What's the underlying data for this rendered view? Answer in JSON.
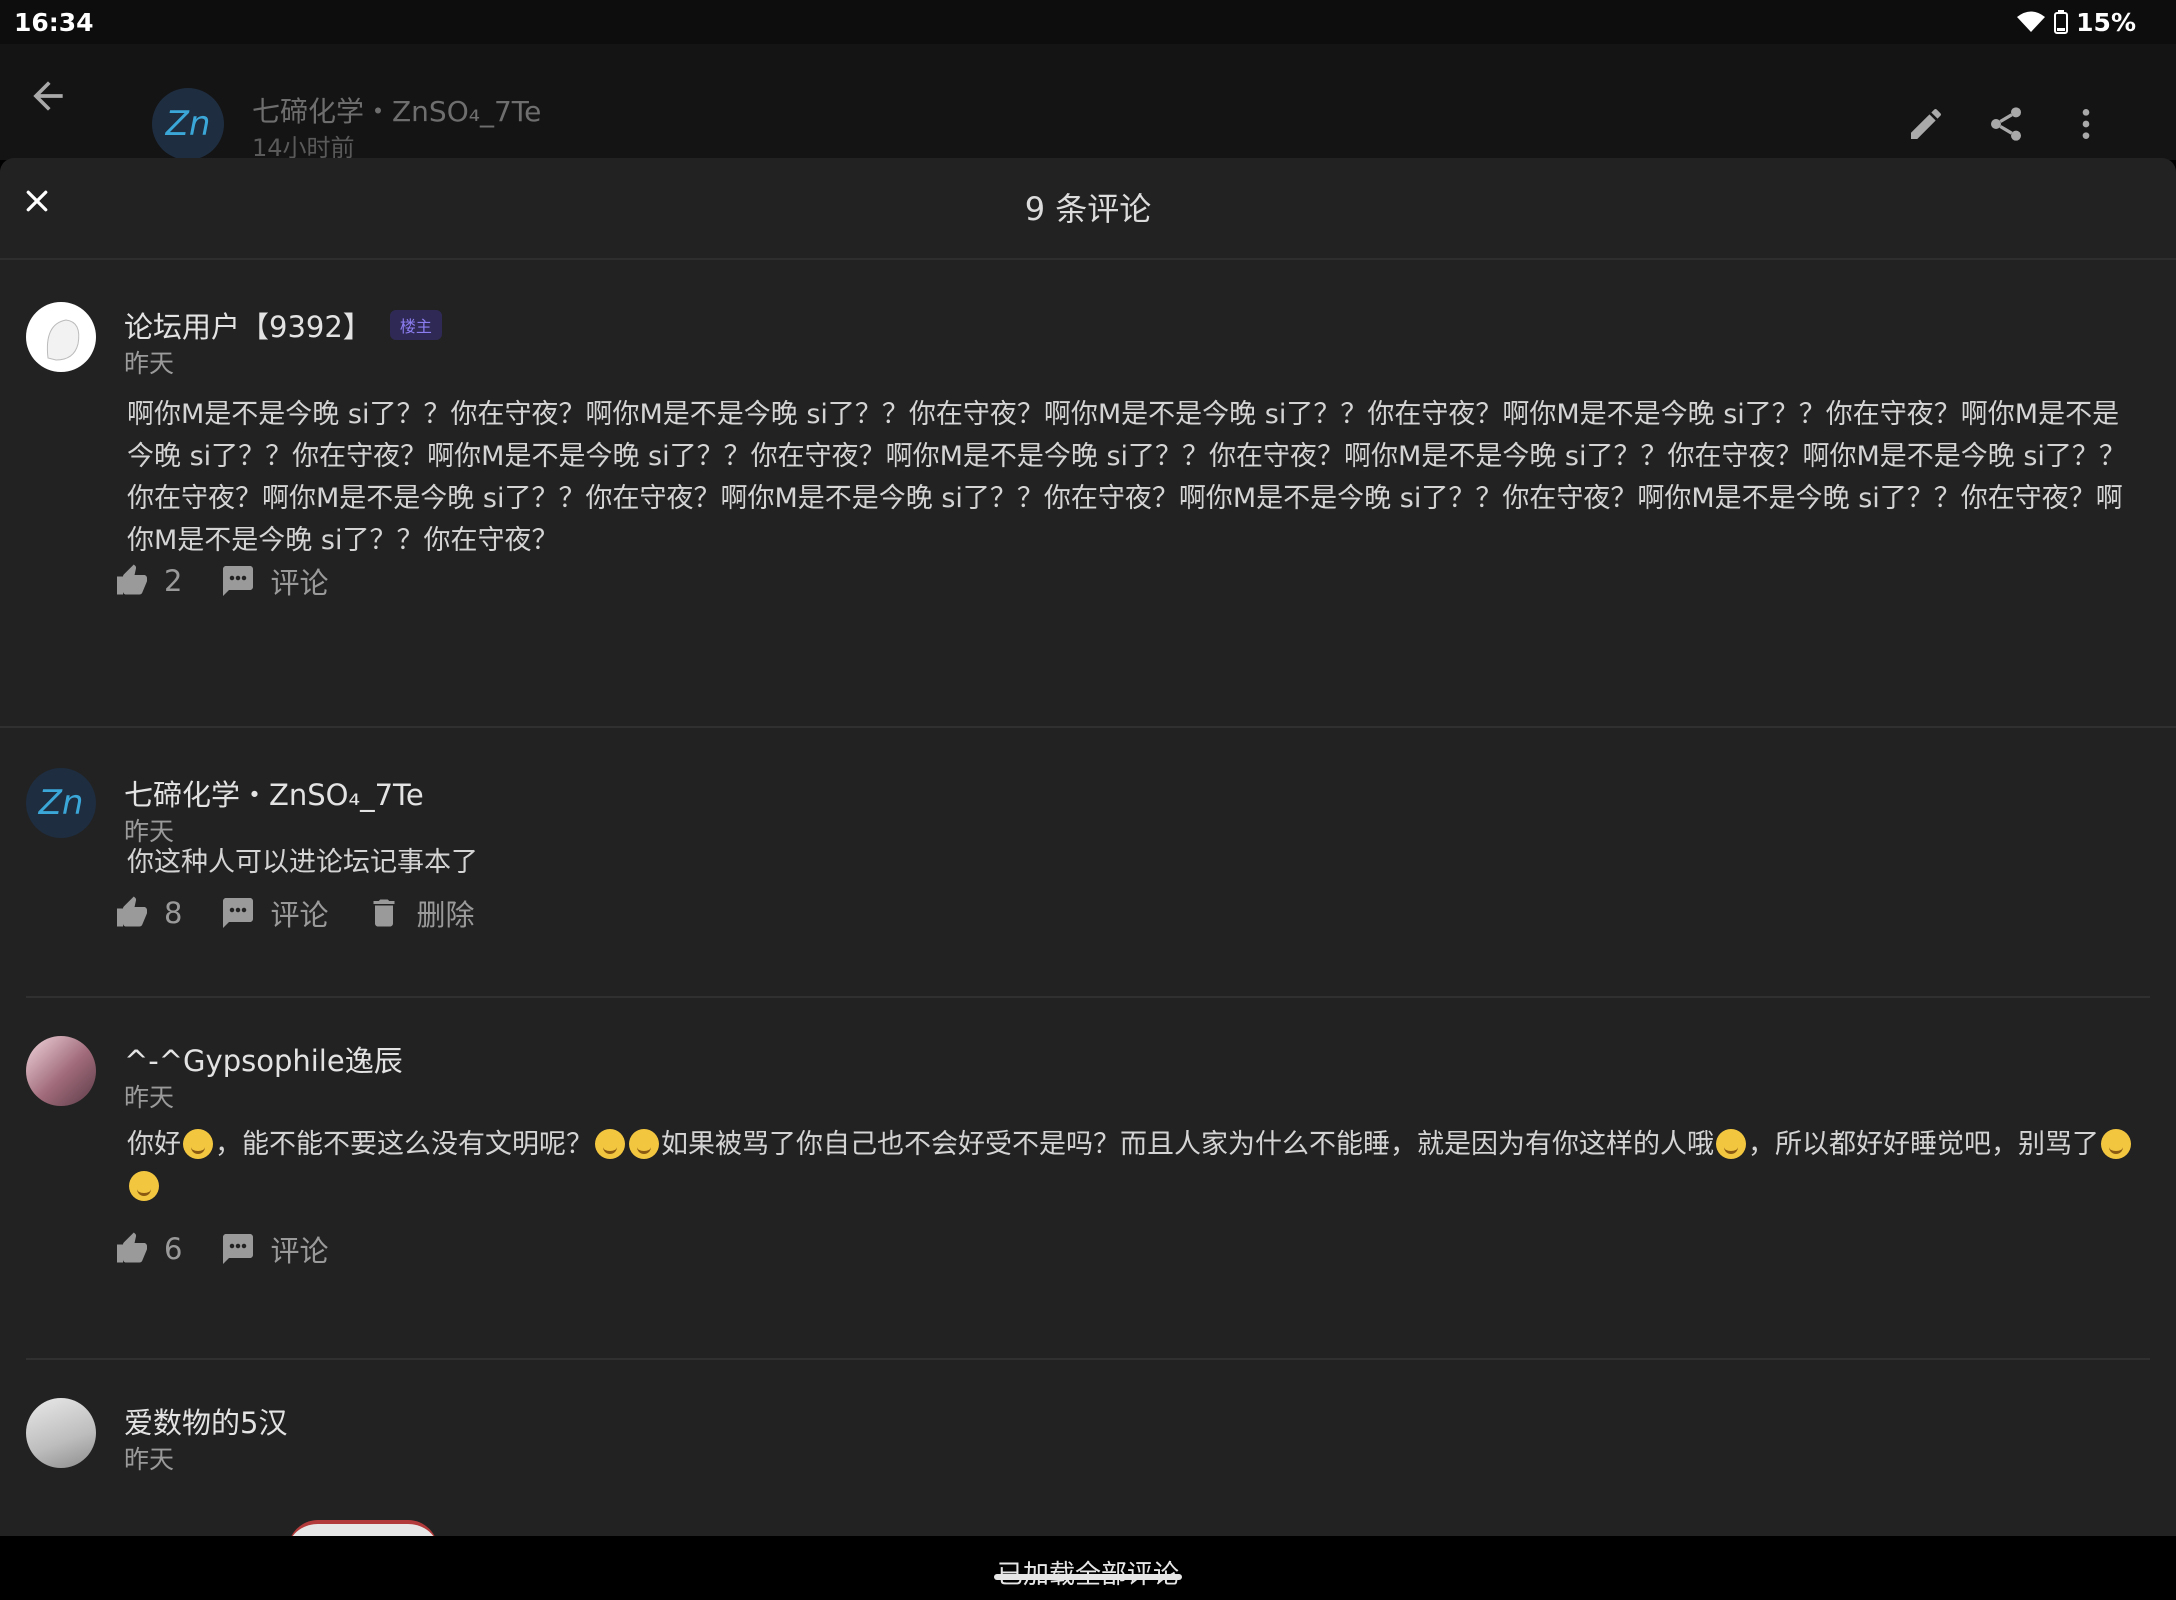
{
  "status_bar": {
    "time": "16:34",
    "battery": "15%"
  },
  "app_bar": {
    "avatar_text": "Zn",
    "title": "七碲化学・ZnSO₄_7Te",
    "subtitle": "14小时前"
  },
  "sheet": {
    "title": "9 条评论",
    "comments": [
      {
        "name": "论坛用户【9392】",
        "badge": "楼主",
        "time": "昨天",
        "body": "啊你M是不是今晚 si了？？你在守夜？啊你M是不是今晚 si了？？你在守夜？啊你M是不是今晚 si了？？你在守夜？啊你M是不是今晚 si了？？你在守夜？啊你M是不是今晚 si了？？你在守夜？啊你M是不是今晚 si了？？你在守夜？啊你M是不是今晚 si了？？你在守夜？啊你M是不是今晚 si了？？你在守夜？啊你M是不是今晚 si了？？你在守夜？啊你M是不是今晚 si了？？你在守夜？啊你M是不是今晚 si了？？你在守夜？啊你M是不是今晚 si了？？你在守夜？啊你M是不是今晚 si了？？你在守夜？啊你M是不是今晚 si了？？你在守夜？",
        "likes": "2",
        "comment_label": "评论"
      },
      {
        "name": "七碲化学・ZnSO₄_7Te",
        "avatar_text": "Zn",
        "time": "昨天",
        "body": "你这种人可以进论坛记事本了",
        "likes": "8",
        "comment_label": "评论",
        "delete_label": "删除"
      },
      {
        "name": "^-^Gypsophile逸辰",
        "time": "昨天",
        "body_parts": [
          "你好",
          "，能不能不要这么没有文明呢？",
          "如果被骂了你自己也不会好受不是吗？而且人家为什么不能睡，就是因为有你这样的人哦",
          "，所以都好好睡觉吧，别骂了"
        ],
        "likes": "6",
        "comment_label": "评论"
      },
      {
        "name": "爱数物的5汉",
        "time": "昨天"
      }
    ]
  },
  "footer": {
    "loaded_text": "已加载全部评论"
  },
  "colors": {
    "sheet_bg": "#222222",
    "badge": "#8b7cf0",
    "accent": "#3aa7d8"
  },
  "icons": [
    "arrow-back-icon",
    "pencil-icon",
    "share-icon",
    "more-vert-icon",
    "close-icon",
    "thumb-up-icon",
    "comment-icon",
    "trash-icon",
    "wifi-icon",
    "battery-icon"
  ]
}
